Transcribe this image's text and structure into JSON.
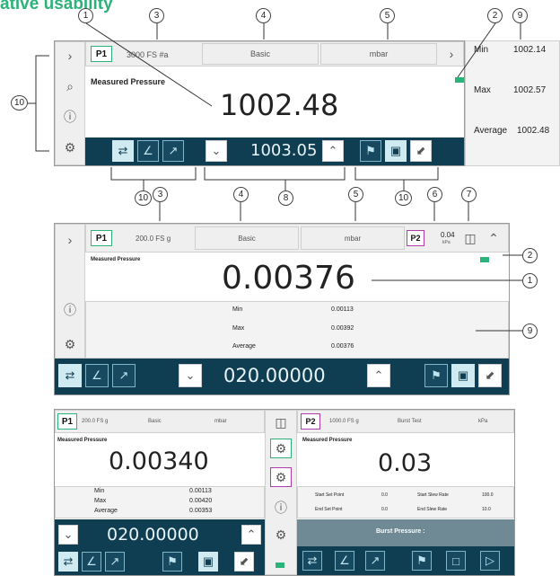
{
  "page": {
    "title_fragment": "ative usability"
  },
  "callouts": {
    "n1": "1",
    "n2": "2",
    "n3": "3",
    "n4": "4",
    "n5": "5",
    "n6": "6",
    "n7": "7",
    "n8": "8",
    "n9": "9",
    "n10": "10"
  },
  "screen1": {
    "channel": "P1",
    "range": "3000 FS #a",
    "mode": "Basic",
    "unit": "mbar",
    "label": "Measured Pressure",
    "value": "1002.48",
    "setpoint": "1003.05",
    "stats": {
      "min_label": "Min",
      "min": "1002.14",
      "max_label": "Max",
      "max": "1002.57",
      "avg_label": "Average",
      "avg": "1002.48"
    }
  },
  "screen2": {
    "channel": "P1",
    "range": "200.0 FS g",
    "mode": "Basic",
    "unit": "mbar",
    "channel2": "P2",
    "small_value": "0.04",
    "small_unit": "kPa",
    "label": "Measured Pressure",
    "value": "0.00376",
    "setpoint": "020.00000",
    "stats": {
      "min_label": "Min",
      "min": "0.00113",
      "max_label": "Max",
      "max": "0.00392",
      "avg_label": "Average",
      "avg": "0.00376"
    }
  },
  "screen3": {
    "left": {
      "channel": "P1",
      "range": "200.0 FS g",
      "mode": "Basic",
      "unit": "mbar",
      "label": "Measured Pressure",
      "value": "0.00340",
      "setpoint": "020.00000",
      "stats": {
        "min_label": "Min",
        "min": "0.00113",
        "max_label": "Max",
        "max": "0.00420",
        "avg_label": "Average",
        "avg": "0.00353"
      }
    },
    "right": {
      "channel": "P2",
      "range": "1000.0 FS g",
      "mode": "Burst Test",
      "unit": "kPa",
      "label": "Measured Pressure",
      "value": "0.03",
      "start_set": "Start Set Point",
      "start_set_val": "0.0",
      "end_set": "End Set Point",
      "end_set_val": "0.0",
      "start_slew": "Start Slew Rate",
      "start_slew_val": "100.0",
      "end_slew": "End Slew Rate",
      "end_slew_val": "10.0",
      "burst": "Burst Pressure :"
    }
  },
  "icons": {
    "accent": "#2bb37a",
    "bar": "#0f3d52",
    "alt": "#b03cb0"
  }
}
